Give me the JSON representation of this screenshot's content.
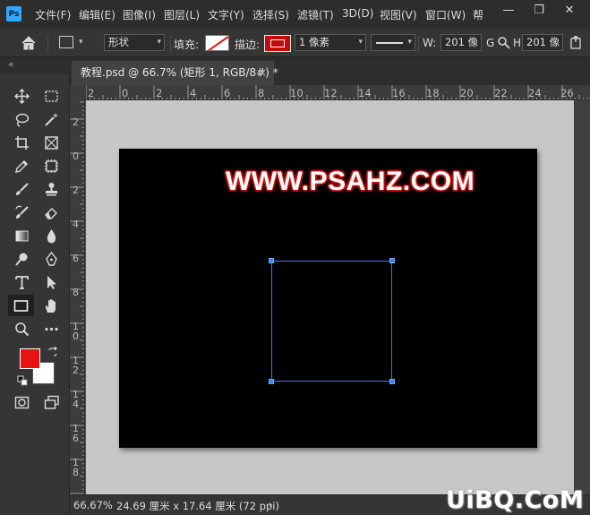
{
  "menubar": {
    "items": [
      "文件(F)",
      "编辑(E)",
      "图像(I)",
      "图层(L)",
      "文字(Y)",
      "选择(S)",
      "滤镜(T)",
      "3D(D)",
      "视图(V)",
      "窗口(W)",
      "帮"
    ],
    "minimize": "—",
    "restore": "❐",
    "close": "✕"
  },
  "options": {
    "mode": "形状",
    "fill_label": "填充:",
    "stroke_label": "描边:",
    "stroke_width": "1 像素",
    "w_label": "W:",
    "w_value": "201 像",
    "g_label": "G",
    "h_value": "201 像"
  },
  "document": {
    "tab_title": "教程.psd @ 66.7% (矩形 1, RGB/8#) *",
    "close": "×",
    "ruler_h": [
      "2",
      "0",
      "2",
      "4",
      "6",
      "8",
      "10",
      "12",
      "14",
      "16",
      "18",
      "20",
      "22",
      "24",
      "26"
    ],
    "ruler_v": [
      "2",
      "0",
      "2",
      "4",
      "6",
      "8",
      "1 0",
      "1 2",
      "1 4",
      "1 6",
      "1 8"
    ],
    "canvas_text": "WWW.PSAHZ.COM"
  },
  "status": {
    "zoom": "66.67%",
    "info": "24.69 厘米 x 17.64 厘米 (72 ppi)",
    "arrow": "›"
  },
  "tools_panel": {
    "collapse": "«"
  },
  "brand_logo": "UiBQ.CoM",
  "colors": {
    "foreground": "#e51313",
    "background": "#ffffff",
    "accent": "#31a8ff"
  }
}
